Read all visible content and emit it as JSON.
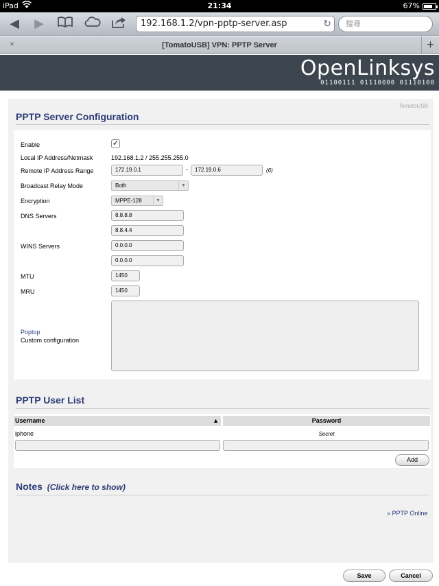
{
  "status": {
    "device": "iPad",
    "time": "21:34",
    "battery": "67%"
  },
  "browser": {
    "url": "192.168.1.2/vpn-pptp-server.asp",
    "search_placeholder": "搜尋",
    "tab_title": "[TomatoUSB] VPN: PPTP Server",
    "tab_close": "×",
    "tab_add": "+",
    "icons": [
      "back-icon",
      "forward-icon",
      "bookmarks-icon",
      "cloud-icon",
      "share-icon",
      "reload-icon"
    ]
  },
  "banner": {
    "logo": "OpenLinksys",
    "bits": "01100111 01110000 01110100"
  },
  "version_tag": "TomatoUSB",
  "config": {
    "title": "PPTP Server Configuration",
    "enable_label": "Enable",
    "enable_checked": true,
    "local_ip_label": "Local IP Address/Netmask",
    "local_ip_value": "192.168.1.2 / 255.255.255.0",
    "remote_range_label": "Remote IP Address Range",
    "remote_start": "172.19.0.1",
    "remote_end": "172.19.0.6",
    "remote_sep": "-",
    "remote_count": "(6)",
    "broadcast_label": "Broadcast Relay Mode",
    "broadcast_value": "Both",
    "encryption_label": "Encryption",
    "encryption_value": "MPPE-128",
    "dns_label": "DNS Servers",
    "dns1": "8.8.8.8",
    "dns2": "8.8.4.4",
    "wins_label": "WINS Servers",
    "wins1": "0.0.0.0",
    "wins2": "0.0.0.0",
    "mtu_label": "MTU",
    "mtu_value": "1450",
    "mru_label": "MRU",
    "mru_value": "1450",
    "custom_link": "Poptop",
    "custom_label": "Custom configuration",
    "custom_value": ""
  },
  "userlist": {
    "title": "PPTP User List",
    "col_username": "Username",
    "sort_indicator": "▲",
    "col_password": "Password",
    "rows": [
      {
        "username": "iphone",
        "password": "Secret"
      }
    ],
    "new_username": "",
    "new_password": "",
    "add_label": "Add"
  },
  "notes": {
    "title": "Notes",
    "toggle": "(Click here to show)"
  },
  "online_link": "» PPTP Online",
  "footer": {
    "save_label": "Save",
    "cancel_label": "Cancel"
  }
}
